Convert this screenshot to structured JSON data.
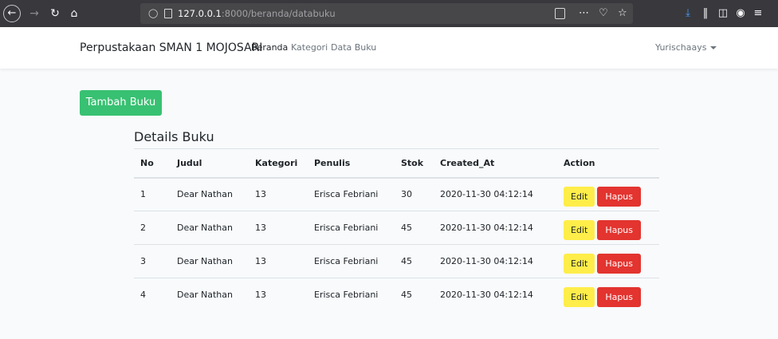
{
  "browser": {
    "url_host": "127.0.0.1",
    "url_rest": ":8000/beranda/databuku"
  },
  "navbar": {
    "brand": "Perpustakaan SMAN 1 MOJOSARI",
    "links": [
      "Beranda",
      "Kategori",
      "Data Buku"
    ],
    "user": "Yurischaays"
  },
  "content": {
    "add_button": "Tambah Buku",
    "section_title": "Details Buku",
    "columns": [
      "No",
      "Judul",
      "Kategori",
      "Penulis",
      "Stok",
      "Created_At",
      "Action"
    ],
    "rows": [
      {
        "no": "1",
        "judul": "Dear Nathan",
        "kategori": "13",
        "penulis": "Erisca Febriani",
        "stok": "30",
        "created_at": "2020-11-30 04:12:14"
      },
      {
        "no": "2",
        "judul": "Dear Nathan",
        "kategori": "13",
        "penulis": "Erisca Febriani",
        "stok": "45",
        "created_at": "2020-11-30 04:12:14"
      },
      {
        "no": "3",
        "judul": "Dear Nathan",
        "kategori": "13",
        "penulis": "Erisca Febriani",
        "stok": "45",
        "created_at": "2020-11-30 04:12:14"
      },
      {
        "no": "4",
        "judul": "Dear Nathan",
        "kategori": "13",
        "penulis": "Erisca Febriani",
        "stok": "45",
        "created_at": "2020-11-30 04:12:14"
      }
    ],
    "edit_label": "Edit",
    "delete_label": "Hapus"
  },
  "colors": {
    "success": "#38c172",
    "warning": "#ffed4a",
    "danger": "#e3342f"
  }
}
